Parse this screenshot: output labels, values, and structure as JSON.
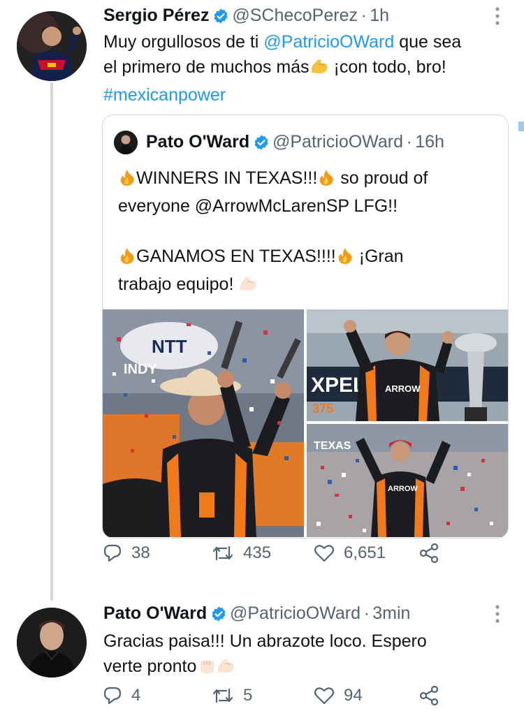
{
  "tweet1": {
    "name": "Sergio Pérez",
    "handle": "@SChecoPerez",
    "time_sep": "·",
    "time": "1h",
    "text_line1_pre": "Muy orgullosos de ti ",
    "mention": "@PatricioOWard",
    "text_line1_post": " que sea",
    "text_line2_pre": "el primero de muchos más",
    "text_line2_post": " ¡con todo, bro!",
    "hashtag": "#mexicanpower",
    "replies": "38",
    "retweets": "435",
    "likes": "6,651"
  },
  "quote": {
    "name": "Pato O'Ward",
    "handle": "@PatricioOWard",
    "time_sep": "·",
    "time": "16h",
    "line1_a": "WINNERS IN TEXAS!!!",
    "line1_b": " so proud of",
    "line2": "everyone @ArrowMcLarenSP  LFG!!",
    "line3_a": "GANAMOS EN TEXAS!!!!",
    "line3_b": " ¡Gran",
    "line4": "trabajo equipo! ",
    "photo1_sign_top": "NTT",
    "photo1_sign_side": "INDY",
    "photo2_banner": "XPEL",
    "photo2_banner2": "375",
    "photo2_suit": "ARROW",
    "photo3_suit": "ARROW",
    "photo3_banner": "TEXAS"
  },
  "tweet2": {
    "name": "Pato O'Ward",
    "handle": "@PatricioOWard",
    "time_sep": "·",
    "time": "3min",
    "line1": "Gracias paisa!!! Un abrazote loco. Espero",
    "line2": "verte pronto",
    "replies": "4",
    "retweets": "5",
    "likes": "94"
  },
  "colors": {
    "accent": "#1d9bf0",
    "secondary_text": "#536471",
    "orange": "#f07a1a"
  }
}
